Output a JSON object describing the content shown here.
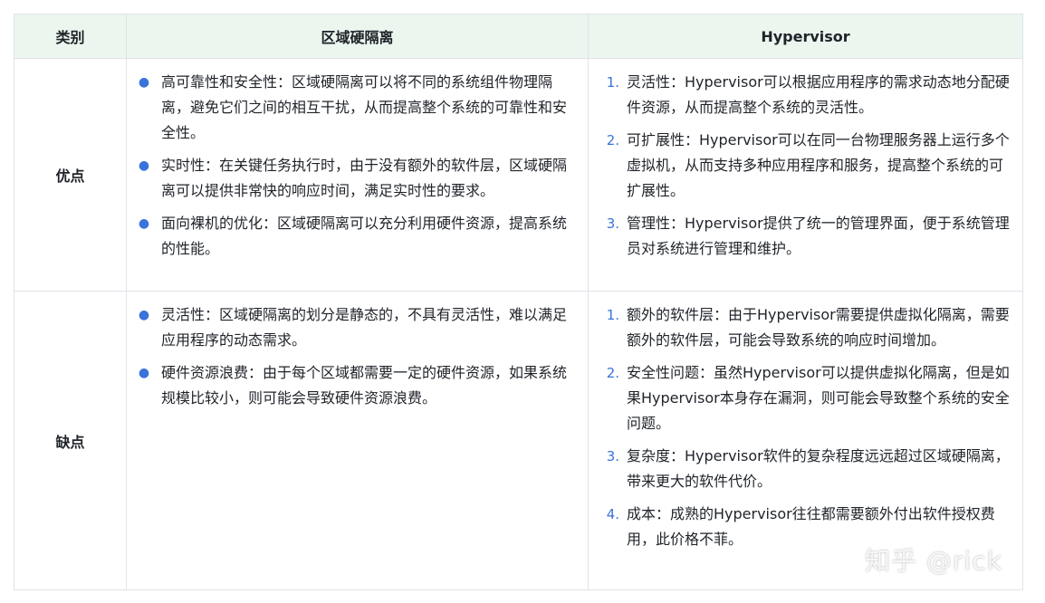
{
  "header": {
    "category": "类别",
    "col_a": "区域硬隔离",
    "col_b": "Hypervisor"
  },
  "rows": [
    {
      "category": "优点",
      "a_items": [
        "高可靠性和安全性：区域硬隔离可以将不同的系统组件物理隔离，避免它们之间的相互干扰，从而提高整个系统的可靠性和安全性。",
        "实时性：在关键任务执行时，由于没有额外的软件层，区域硬隔离可以提供非常快的响应时间，满足实时性的要求。",
        "面向裸机的优化：区域硬隔离可以充分利用硬件资源，提高系统的性能。"
      ],
      "b_items": [
        {
          "num": "1.",
          "text": "灵活性：Hypervisor可以根据应用程序的需求动态地分配硬件资源，从而提高整个系统的灵活性。"
        },
        {
          "num": "2.",
          "text": "可扩展性：Hypervisor可以在同一台物理服务器上运行多个虚拟机，从而支持多种应用程序和服务，提高整个系统的可扩展性。"
        },
        {
          "num": "3.",
          "text": "管理性：Hypervisor提供了统一的管理界面，便于系统管理员对系统进行管理和维护。"
        }
      ]
    },
    {
      "category": "缺点",
      "a_items": [
        "灵活性：区域硬隔离的划分是静态的，不具有灵活性，难以满足应用程序的动态需求。",
        "硬件资源浪费：由于每个区域都需要一定的硬件资源，如果系统规模比较小，则可能会导致硬件资源浪费。"
      ],
      "b_items": [
        {
          "num": "1.",
          "text": "额外的软件层：由于Hypervisor需要提供虚拟化隔离，需要额外的软件层，可能会导致系统的响应时间增加。"
        },
        {
          "num": "2.",
          "text": "安全性问题：虽然Hypervisor可以提供虚拟化隔离，但是如果Hypervisor本身存在漏洞，则可能会导致整个系统的安全问题。"
        },
        {
          "num": "3.",
          "text": "复杂度：Hypervisor软件的复杂程度远远超过区域硬隔离，带来更大的软件代价。"
        },
        {
          "num": "4.",
          "text": "成本：成熟的Hypervisor往往都需要额外付出软件授权费用，此价格不菲。"
        }
      ]
    }
  ],
  "watermark": "知乎 @rick",
  "colors": {
    "header_bg": "#eaf6ee",
    "border": "#dfe3e8",
    "bullet": "#3a73d9"
  }
}
